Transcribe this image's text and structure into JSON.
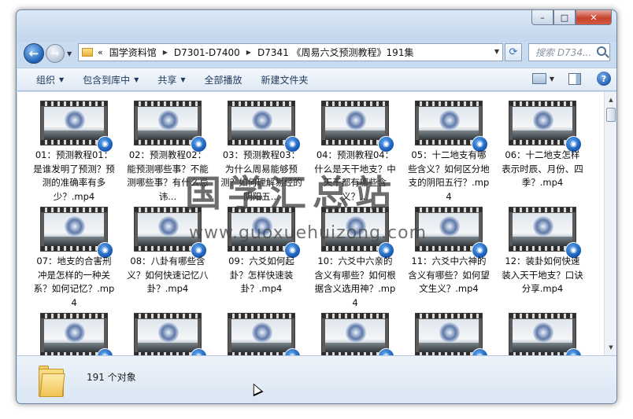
{
  "window": {
    "minimize_glyph": "–",
    "maximize_glyph": "□",
    "close_glyph": "✕"
  },
  "navigation": {
    "back_glyph": "←",
    "forward_glyph": "→"
  },
  "address": {
    "chevrons": "«",
    "crumbs": [
      "国学资料馆",
      "D7301-D7400",
      "D7341 《周易六爻预测教程》191集"
    ],
    "separator": "▶"
  },
  "search": {
    "placeholder": "搜索 D734..."
  },
  "toolbar": {
    "organize": "组织",
    "include_in_library": "包含到库中",
    "share": "共享",
    "play_all": "全部播放",
    "new_folder": "新建文件夹"
  },
  "files": [
    {
      "name": "01：预测教程01：是谁发明了预测？预测的准确率有多少？.mp4"
    },
    {
      "name": "02：预测教程02：能预测哪些事？不能测哪些事？有什么忌讳..."
    },
    {
      "name": "03：预测教程03：为什么周易能够预测？如何理解易经的阴阳五..."
    },
    {
      "name": "04：预测教程04：什么是天干地支？中天干都有哪些含义？..."
    },
    {
      "name": "05：十二地支有哪些含义？如何区分地支的阴阳五行？.mp4"
    },
    {
      "name": "06：十二地支怎样表示时辰、月份、四季？.mp4"
    },
    {
      "name": "07：地支的合害刑冲是怎样的一种关系？如何记忆？.mp4"
    },
    {
      "name": "08：八卦有哪些含义？如何快速记忆八卦？.mp4"
    },
    {
      "name": "09：六爻如何起卦？怎样快速装卦？.mp4"
    },
    {
      "name": "10：六爻中六亲的含义有哪些？如何根据含义选用神？.mp4"
    },
    {
      "name": "11：六爻中六神的含义有哪些？如何望文生义？.mp4"
    },
    {
      "name": "12：装卦如何快速装入天干地支？口诀分享.mp4"
    },
    {
      "name": ""
    },
    {
      "name": ""
    },
    {
      "name": ""
    },
    {
      "name": ""
    },
    {
      "name": ""
    },
    {
      "name": ""
    }
  ],
  "status": {
    "count_text": "191 个对象"
  },
  "watermark": {
    "title": "国学汇总站",
    "url": "www.guoxuehuizong.com"
  }
}
